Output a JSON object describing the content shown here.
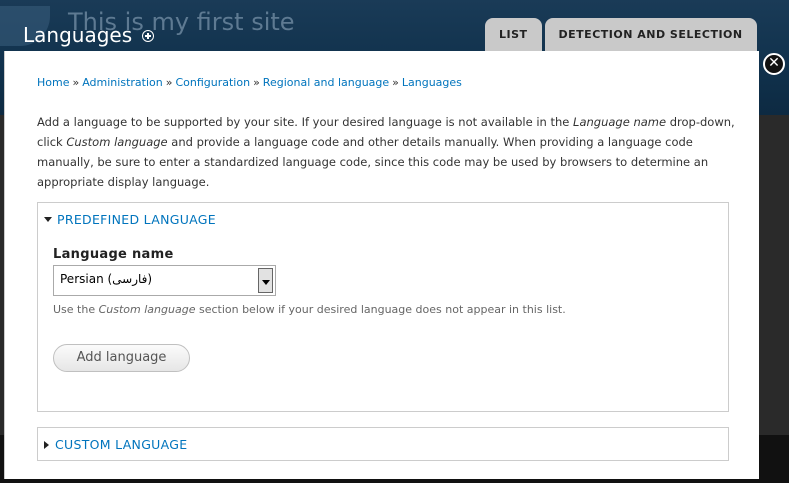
{
  "site": {
    "name": "This is my first site"
  },
  "header": {
    "title": "Languages"
  },
  "tabs": [
    {
      "label": "LIST"
    },
    {
      "label": "DETECTION AND SELECTION"
    }
  ],
  "overlay": {
    "close_symbol": "✕"
  },
  "breadcrumb": [
    "Home",
    "Administration",
    "Configuration",
    "Regional and language",
    "Languages"
  ],
  "help": {
    "p1": "Add a language to be supported by your site. If your desired language is not available in the ",
    "em1": "Language name",
    "p2": " drop-down, click ",
    "em2": "Custom language",
    "p3": " and provide a language code and other details manually. When providing a language code manually, be sure to enter a standardized language code, since this code may be used by browsers to determine an appropriate display language."
  },
  "predefined": {
    "legend": "PREDEFINED LANGUAGE",
    "label": "Language name",
    "selected": "Persian (فارسی)",
    "desc_pre": "Use the ",
    "desc_em": "Custom language",
    "desc_post": " section below if your desired language does not appear in this list.",
    "button": "Add language"
  },
  "custom": {
    "legend": "CUSTOM LANGUAGE"
  }
}
